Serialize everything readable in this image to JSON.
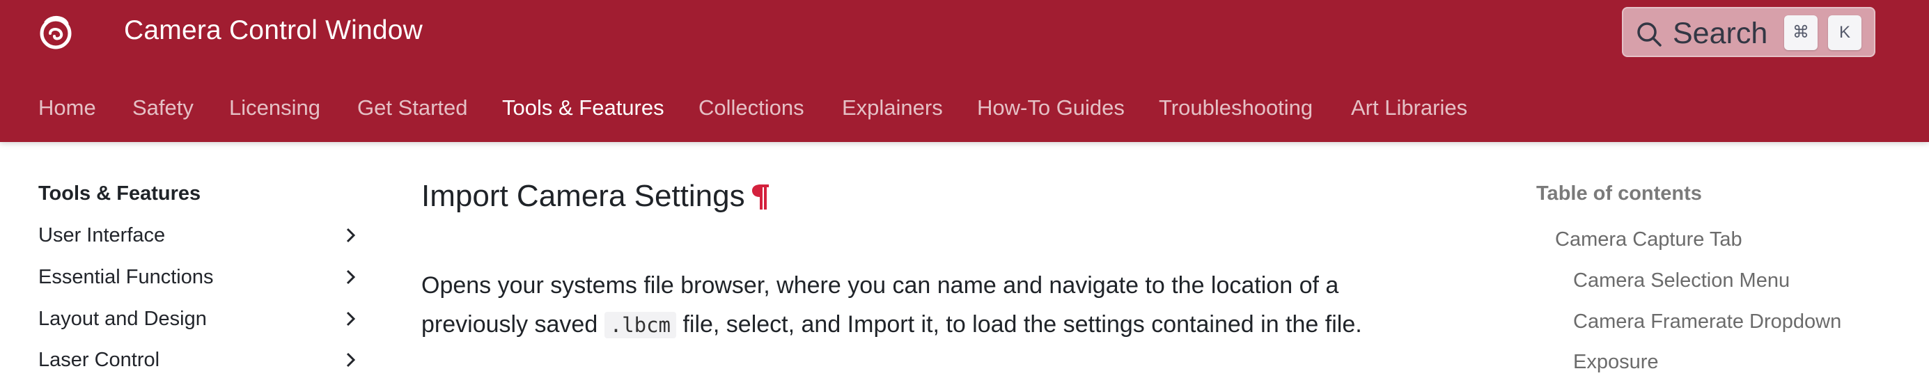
{
  "header": {
    "site_title": "Camera Control Window",
    "logo_icon": "swirl-logo-icon",
    "search": {
      "label": "Search",
      "shortcut_keys": [
        "⌘",
        "K"
      ]
    },
    "nav_tabs": [
      {
        "label": "Home",
        "active": false
      },
      {
        "label": "Safety",
        "active": false
      },
      {
        "label": "Licensing",
        "active": false
      },
      {
        "label": "Get Started",
        "active": false
      },
      {
        "label": "Tools & Features",
        "active": true
      },
      {
        "label": "Collections",
        "active": false
      },
      {
        "label": "Explainers",
        "active": false
      },
      {
        "label": "How-To Guides",
        "active": false
      },
      {
        "label": "Troubleshooting",
        "active": false
      },
      {
        "label": "Art Libraries",
        "active": false
      }
    ]
  },
  "sidebar": {
    "title": "Tools & Features",
    "items": [
      {
        "label": "User Interface"
      },
      {
        "label": "Essential Functions"
      },
      {
        "label": "Layout and Design"
      },
      {
        "label": "Laser Control"
      }
    ]
  },
  "main": {
    "heading": "Import Camera Settings",
    "anchor_symbol": "¶",
    "paragraph": {
      "before_code": "Opens your systems file browser, where you can name and navigate to the location of a previously saved ",
      "code": ".lbcm",
      "after_code": " file, select, and Import it, to load the settings contained in the file."
    }
  },
  "toc": {
    "title": "Table of contents",
    "links": [
      {
        "label": "Camera Capture Tab",
        "level": 1
      },
      {
        "label": "Camera Selection Menu",
        "level": 2
      },
      {
        "label": "Camera Framerate Dropdown",
        "level": 2
      },
      {
        "label": "Exposure",
        "level": 2
      }
    ]
  },
  "colors": {
    "header_bg": "#a11d31",
    "anchor_accent": "#d4213d",
    "search_bg": "#d7a0aa"
  }
}
